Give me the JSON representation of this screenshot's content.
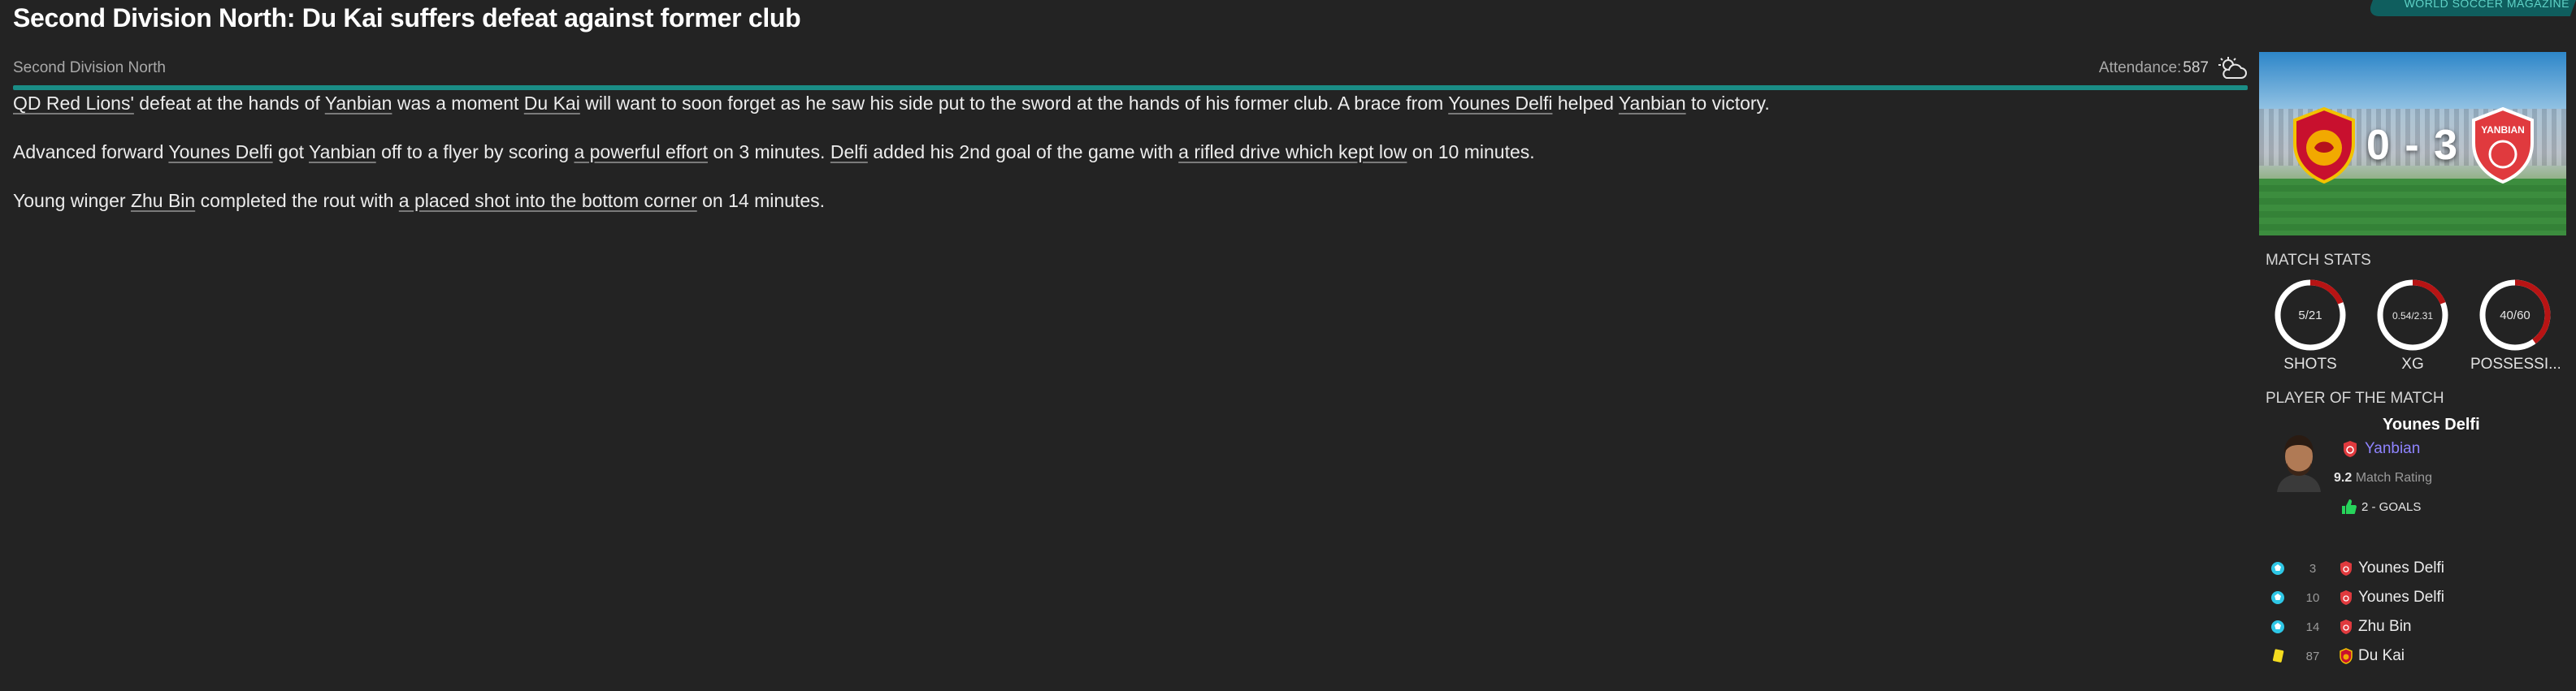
{
  "header": {
    "headline": "Second Division North: Du Kai suffers defeat against former club",
    "brand": "WORLD SOCCER MAGAZINE"
  },
  "subheader": {
    "competition": "Second Division North",
    "attendance_label": "Attendance:",
    "attendance_value": "587",
    "weather_icon": "partly-cloudy-icon"
  },
  "article": {
    "p1": {
      "a": "QD Red Lions'",
      "b": " defeat at the hands of ",
      "c": "Yanbian",
      "d": " was a moment ",
      "e": "Du Kai",
      "f": " will want to soon forget as he saw his side put to the sword at the hands of his former club. A brace from ",
      "g": "Younes Delfi",
      "h": " helped ",
      "i": "Yanbian",
      "j": " to victory."
    },
    "p2": {
      "a": "Advanced forward ",
      "b": "Younes Delfi",
      "c": " got ",
      "d": "Yanbian",
      "e": " off to a flyer by scoring ",
      "f": "a powerful effort",
      "g": " on 3 minutes. ",
      "h": "Delfi",
      "i": " added his 2nd goal of the game with ",
      "j": "a rifled drive which kept low",
      "k": " on 10 minutes."
    },
    "p3": {
      "a": "Young winger ",
      "b": "Zhu Bin",
      "c": " completed the rout with ",
      "d": "a placed shot into the bottom corner",
      "e": " on 14 minutes."
    }
  },
  "score_card": {
    "score": "0 - 3",
    "home_crest": "QD Red Lions crest",
    "away_crest": "YANBIAN"
  },
  "match_stats": {
    "title": "MATCH STATS",
    "items": [
      {
        "value": "5/21",
        "label": "SHOTS",
        "home_share": 0.19
      },
      {
        "value": "0.54/2.31",
        "label": "XG",
        "home_share": 0.19
      },
      {
        "value": "40/60",
        "label": "POSSESSI...",
        "home_share": 0.4
      }
    ],
    "colors": {
      "home": "#b71414",
      "away": "#ffffff"
    }
  },
  "player_of_match": {
    "title": "PLAYER OF THE MATCH",
    "name": "Younes Delfi",
    "club": "Yanbian",
    "rating_value": "9.2",
    "rating_label": "Match Rating",
    "goals_text": "2 - GOALS"
  },
  "events": [
    {
      "type": "goal",
      "icon": "ball-icon",
      "minute": "3",
      "player": "Younes Delfi",
      "team": "away"
    },
    {
      "type": "goal",
      "icon": "ball-icon",
      "minute": "10",
      "player": "Younes Delfi",
      "team": "away"
    },
    {
      "type": "goal",
      "icon": "ball-icon",
      "minute": "14",
      "player": "Zhu Bin",
      "team": "away"
    },
    {
      "type": "yellow-card",
      "icon": "yellow-card-icon",
      "minute": "87",
      "player": "Du Kai",
      "team": "home"
    }
  ]
}
